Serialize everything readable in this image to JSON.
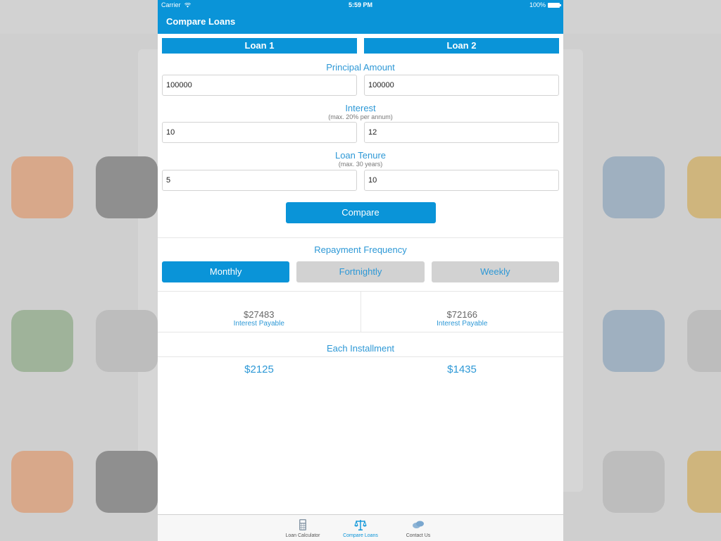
{
  "status_bar": {
    "carrier": "Carrier",
    "time": "5:59 PM",
    "battery": "100%"
  },
  "nav": {
    "title": "Compare Loans"
  },
  "loans": {
    "loan1_label": "Loan 1",
    "loan2_label": "Loan 2"
  },
  "principal": {
    "title": "Principal Amount",
    "loan1": "100000",
    "loan2": "100000"
  },
  "interest": {
    "title": "Interest",
    "subtitle": "(max. 20% per annum)",
    "loan1": "10",
    "loan2": "12"
  },
  "tenure": {
    "title": "Loan Tenure",
    "subtitle": "(max. 30 years)",
    "loan1": "5",
    "loan2": "10"
  },
  "compare_button": "Compare",
  "frequency": {
    "title": "Repayment Frequency",
    "options": [
      "Monthly",
      "Fortnightly",
      "Weekly"
    ],
    "selected": "Monthly"
  },
  "results": {
    "loan1_interest": "$27483",
    "loan2_interest": "$72166",
    "interest_label": "Interest Payable",
    "installment_title": "Each Installment",
    "loan1_installment": "$2125",
    "loan2_installment": "$1435"
  },
  "tabbar": {
    "items": [
      {
        "label": "Loan Calculator",
        "icon": "calculator-icon"
      },
      {
        "label": "Compare Loans",
        "icon": "scale-icon"
      },
      {
        "label": "Contact Us",
        "icon": "chat-bubbles-icon"
      }
    ]
  },
  "colors": {
    "primary": "#0a94d8",
    "accent_text": "#2d98d6",
    "inactive_button": "#d2d2d2"
  }
}
